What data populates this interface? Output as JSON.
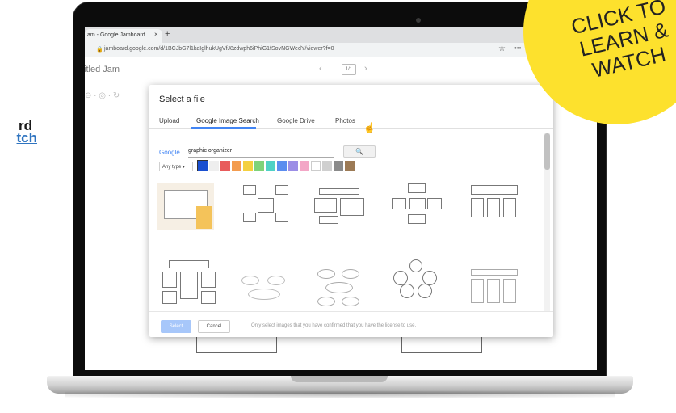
{
  "sidebar": {
    "title": "rd",
    "link": "tch"
  },
  "browser": {
    "tab_title": "am - Google Jamboard",
    "tab_close": "×",
    "new_tab": "+",
    "url": "jamboard.google.com/d/1BCJbG7l1kaIglhukUgVfJ8zdwph6iPhiG1fSovNGWedY/viewer?f=0",
    "star": "☆",
    "dots": "•••"
  },
  "jam": {
    "title": "titled Jam",
    "frame_count": "1/1",
    "prev": "‹",
    "next": "›",
    "tools": "⊖  ·  ◎  ·  ↻"
  },
  "dialog": {
    "title": "Select a file",
    "tabs": [
      "Upload",
      "Google Image Search",
      "Google Drive",
      "Photos"
    ],
    "google_logo": "Google",
    "search_value": "graphic organizer",
    "search_icon": "🔍",
    "type_select": "Any type ▾",
    "swatch_colors": [
      "#1a4fd0",
      "#eeeeee",
      "#e85b5b",
      "#f39c4f",
      "#f4d03f",
      "#7ed37a",
      "#4fd1c5",
      "#5b8def",
      "#9b8ee6",
      "#f3a6c6",
      "#ffffff",
      "#cfcfcf",
      "#8a8a8a",
      "#9c7a55"
    ],
    "select_button": "Select",
    "cancel_button": "Cancel",
    "footer_note": "Only select images that you have confirmed that you have the license to use."
  },
  "sticker": {
    "line1": "CLICK TO",
    "line2": "LEARN &",
    "line3": "WATCH"
  }
}
